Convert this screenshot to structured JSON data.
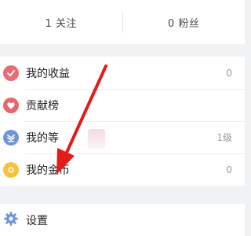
{
  "stats": {
    "following": "1 关注",
    "followers": "0 粉丝"
  },
  "menu": {
    "items": [
      {
        "label": "我的收益",
        "value": "0",
        "icon": "check-icon",
        "color": "#ec6b72"
      },
      {
        "label": "贡献榜",
        "value": "",
        "icon": "heart-icon",
        "color": "#e8666c"
      },
      {
        "label": "我的等",
        "value": "1级",
        "icon": "level-icon",
        "color": "#6f97d8"
      },
      {
        "label": "我的金币",
        "value": "0",
        "icon": "coin-icon",
        "color": "#f6c33b"
      }
    ]
  },
  "settings": {
    "label": "设置",
    "icon": "gear-icon",
    "color": "#6f97d8"
  },
  "annotation": {
    "color": "#e31b1b"
  }
}
